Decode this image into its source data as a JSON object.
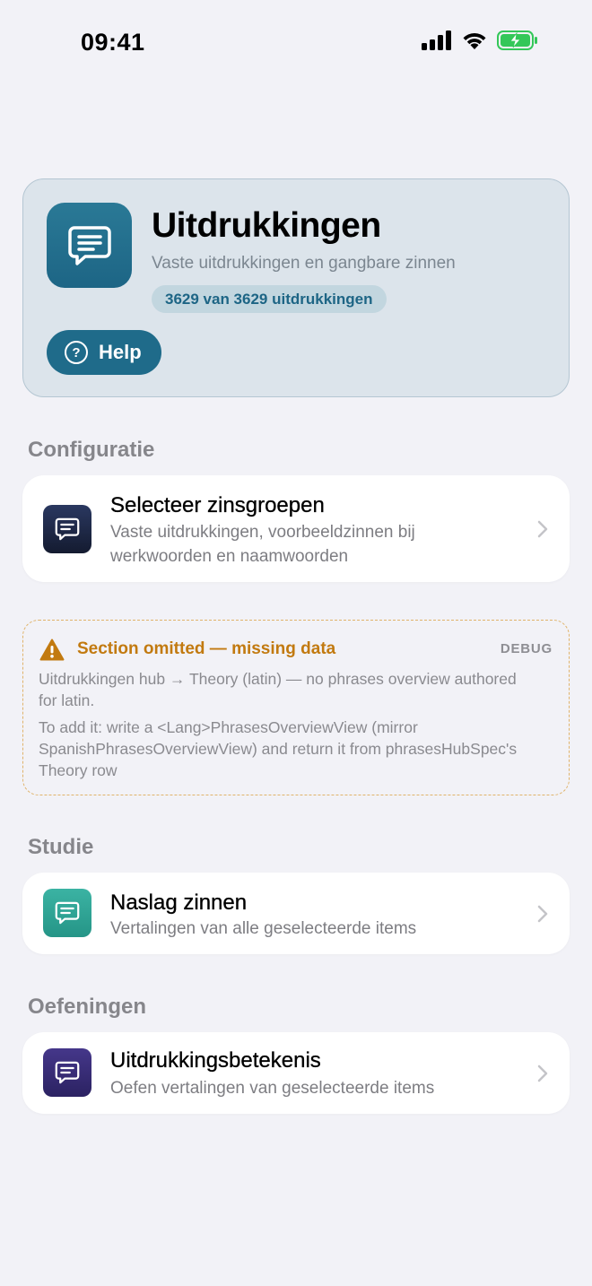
{
  "status": {
    "time": "09:41"
  },
  "hero": {
    "title": "Uitdrukkingen",
    "subtitle": "Vaste uitdrukkingen en gangbare zinnen",
    "badge": "3629 van 3629 uitdrukkingen",
    "help_label": "Help",
    "icon": "chat-bubble-icon"
  },
  "sections": {
    "configuratie": "Configuratie",
    "studie": "Studie",
    "oefeningen": "Oefeningen"
  },
  "rows": {
    "select_groups": {
      "title": "Selecteer zinsgroepen",
      "subtitle": "Vaste uitdrukkingen, voorbeeldzinnen bij werkwoorden en naamwoorden"
    },
    "naslag": {
      "title": "Naslag zinnen",
      "subtitle": "Vertalingen van alle geselecteerde items"
    },
    "betekenis": {
      "title": "Uitdrukkingsbetekenis",
      "subtitle": "Oefen vertalingen van geselecteerde items"
    }
  },
  "debug": {
    "title": "Section omitted — missing data",
    "tag": "DEBUG",
    "line1": "Uitdrukkingen hub → Theory (latin) — no phrases overview authored for latin.",
    "line2": "To add it: write a <Lang>PhrasesOverviewView (mirror SpanishPhrasesOverviewView) and return it from phrasesHubSpec's Theory row"
  },
  "colors": {
    "hero_accent": "#1f6b8a",
    "warning": "#c27a10",
    "icon_navy": "#1e2a4a",
    "icon_teal": "#2a9d8f",
    "icon_purple": "#35296e"
  }
}
